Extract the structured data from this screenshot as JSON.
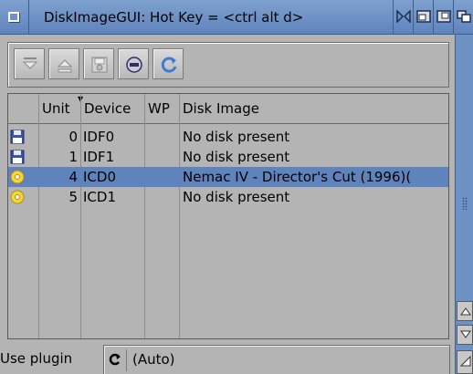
{
  "window": {
    "title": "DiskImageGUI: Hot Key = <ctrl alt d>",
    "title_icons": [
      "iconify-icon",
      "zoom-icon",
      "resize-icon",
      "depth-icon"
    ]
  },
  "toolbar": {
    "buttons": [
      {
        "name": "insert-disk",
        "icon": "arrow-down-icon",
        "enabled": false
      },
      {
        "name": "eject-disk",
        "icon": "eject-icon",
        "enabled": false
      },
      {
        "name": "write-protect",
        "icon": "disk-drive-icon",
        "enabled": false
      },
      {
        "name": "plugins",
        "icon": "plugin-icon",
        "enabled": true
      },
      {
        "name": "refresh",
        "icon": "refresh-icon",
        "enabled": true
      }
    ]
  },
  "table": {
    "columns": [
      "",
      "Unit",
      "Device",
      "WP",
      "Disk Image"
    ],
    "rows": [
      {
        "icon": "floppy-icon",
        "unit": "0",
        "device": "IDF0",
        "wp": "",
        "image": "No disk present",
        "selected": false
      },
      {
        "icon": "cd-icon",
        "unit": "1",
        "device": "IDF1",
        "wp": "",
        "image": "No disk present",
        "selected": false
      },
      {
        "icon": "cd-icon",
        "unit": "4",
        "device": "ICD0",
        "wp": "",
        "image": "Nemac IV - Director's Cut (1996)(",
        "selected": true
      },
      {
        "icon": "cd-icon",
        "unit": "5",
        "device": "ICD1",
        "wp": "",
        "image": "No disk present",
        "selected": false
      }
    ]
  },
  "plugin": {
    "label": "Use plugin",
    "value": "(Auto)"
  },
  "colors": {
    "selection": "#5f84bd",
    "background": "#b4b4b4",
    "titlebar": "#6f92c5"
  }
}
